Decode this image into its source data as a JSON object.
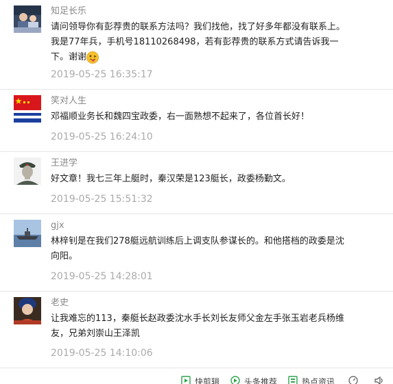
{
  "comments": [
    {
      "author": "知足长乐",
      "text_before_emoji": "请问领导你有彭荐贵的联系方法吗？我们找他，找了好多年都没有联系上。我是77年兵，手机号18110268498，若有彭荐贵的联系方式请告诉我一下。谢谢",
      "has_emoji": true,
      "time": "2019-05-25 16:35:17",
      "avatar_icon": "family-photo-avatar"
    },
    {
      "author": "笑对人生",
      "text_before_emoji": "邓福顺业务长和魏四宝政委，右一面熟想不起来了，各位首长好！",
      "has_emoji": false,
      "time": "2019-05-25 16:24:10",
      "avatar_icon": "naval-flag-avatar"
    },
    {
      "author": "王进学",
      "text_before_emoji": "好文章！我七三年上艇时，秦汉荣是123艇长，政委杨勤文。",
      "has_emoji": false,
      "time": "2019-05-25 15:51:32",
      "avatar_icon": "soldier-portrait-avatar"
    },
    {
      "author": "gjx",
      "text_before_emoji": "林梓钊是在我们278艇远航训练后上调支队参谋长的。和他搭档的政委是沈向阳。",
      "has_emoji": false,
      "time": "2019-05-25 14:28:01",
      "avatar_icon": "ship-photo-avatar"
    },
    {
      "author": "老史",
      "text_before_emoji": "让我难忘的113，秦艇长赵政委沈水手长刘长友师父金左手张玉岩老兵杨维友，兄弟刘崇山王泽凯",
      "has_emoji": false,
      "time": "2019-05-25 14:10:06",
      "avatar_icon": "portrait-avatar"
    }
  ],
  "bottom_bar": {
    "items": [
      {
        "label": "快剪辑",
        "icon": "video-edit-icon"
      },
      {
        "label": "头条推荐",
        "icon": "recommend-icon"
      },
      {
        "label": "热点资讯",
        "icon": "news-icon"
      },
      {
        "label": "",
        "icon": "speed-icon"
      },
      {
        "label": "",
        "icon": "volume-icon"
      }
    ]
  },
  "colors": {
    "author": "#888888",
    "text": "#222222",
    "time": "#aaaaaa",
    "divider": "#e6e6e6",
    "bottom_icon": "#2ea44f"
  }
}
